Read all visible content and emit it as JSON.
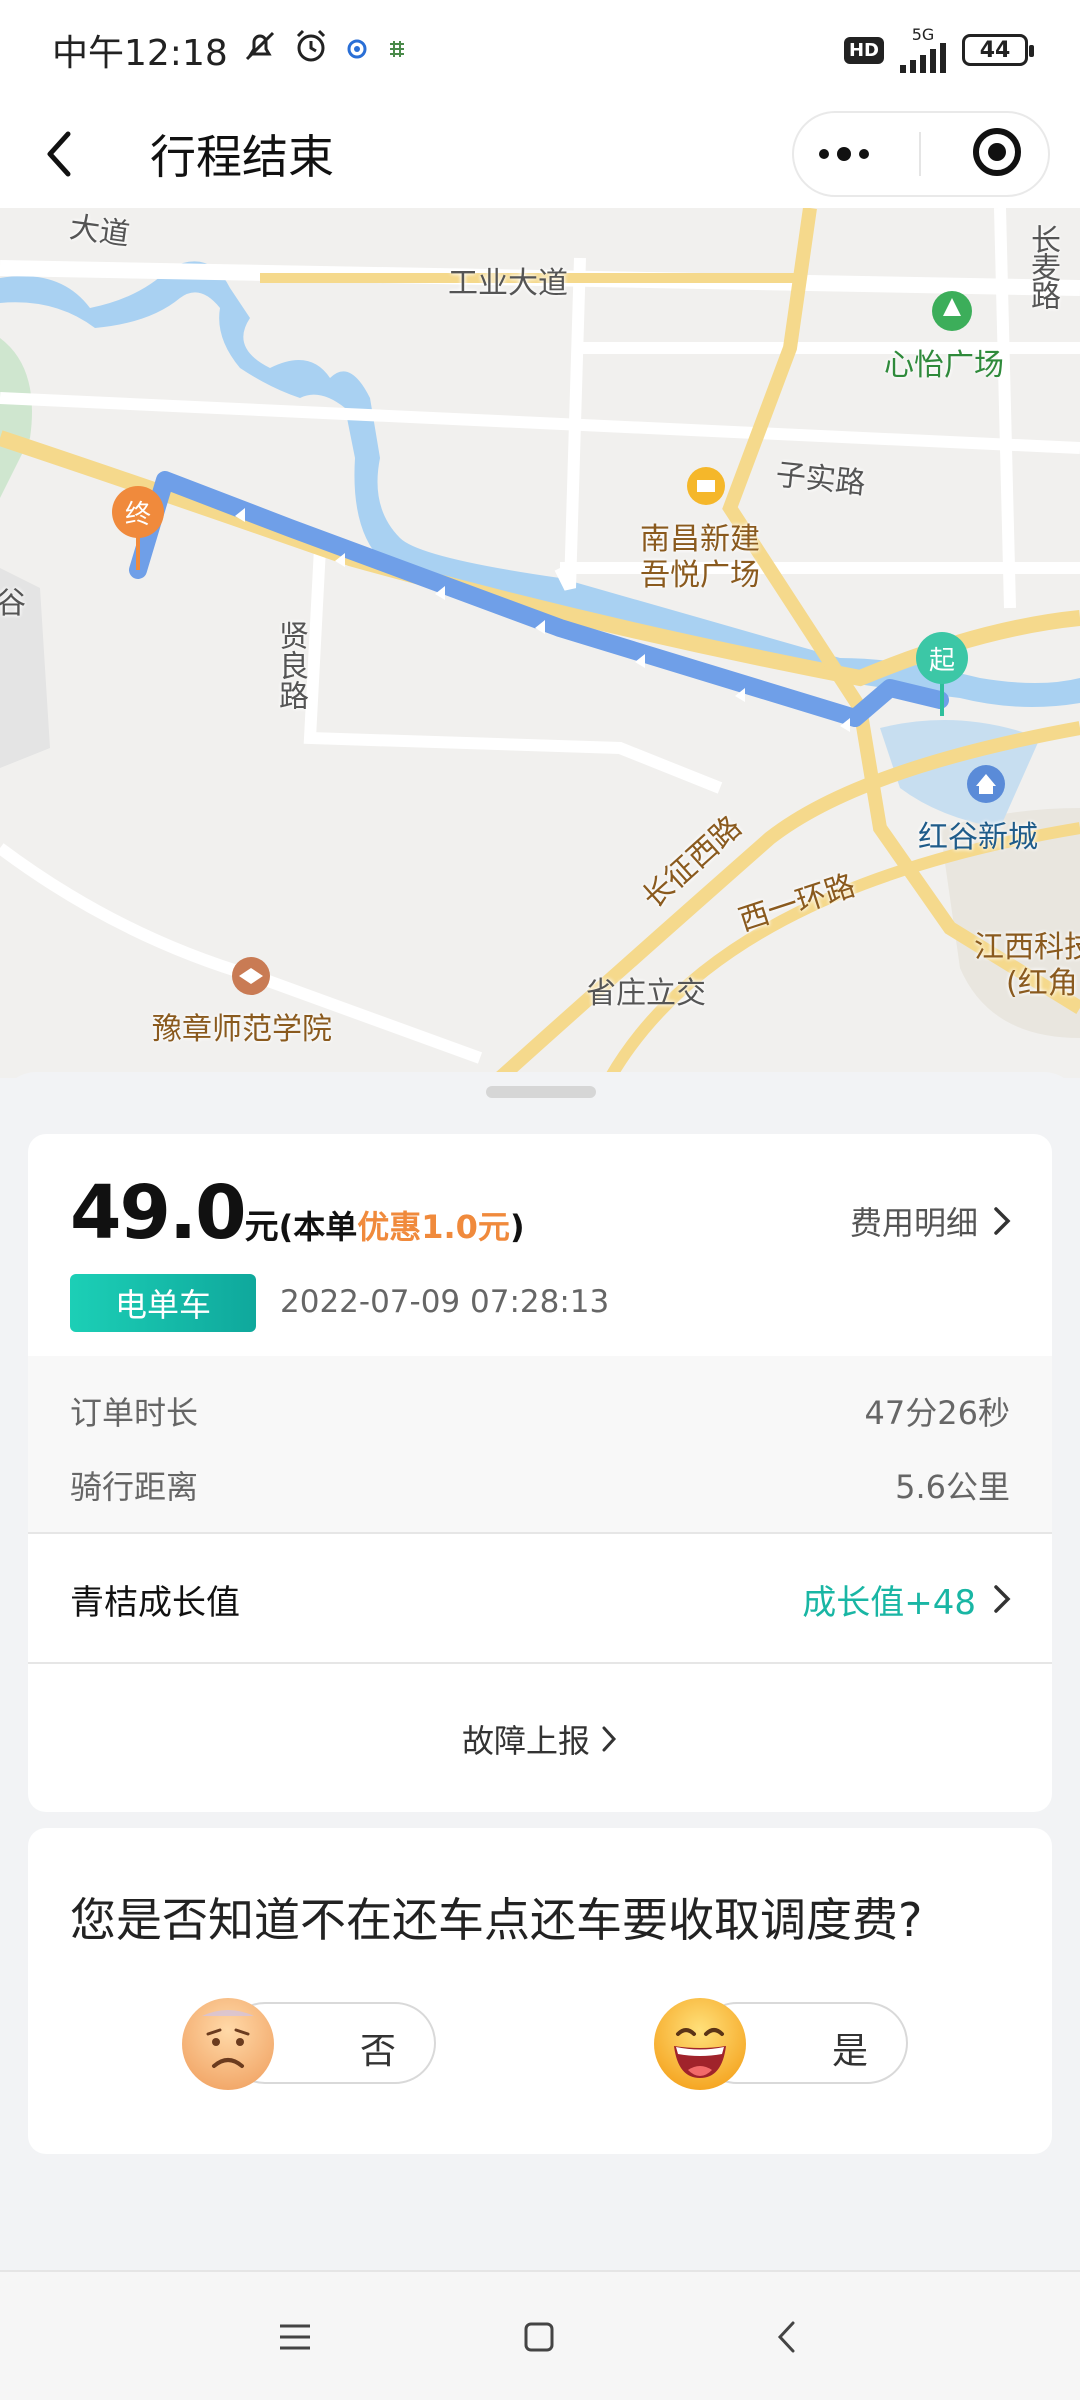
{
  "status_bar": {
    "time": "中午12:18",
    "network": "5G",
    "battery": "44",
    "icons": [
      "mute-bell-icon",
      "alarm-icon",
      "app-notification-icon",
      "hd-icon",
      "signal-icon",
      "battery-icon"
    ]
  },
  "nav": {
    "title": "行程结束",
    "back_icon": "chevron-left-icon",
    "more_icon": "more-dots-icon",
    "close_icon": "target-close-icon"
  },
  "map": {
    "labels": {
      "gongye": "工业大道",
      "changmai": "长麦路",
      "xinyi": "心怡广场",
      "zishi": "子实路",
      "nanchang_1": "南昌新建",
      "nanchang_2": "吾悦广场",
      "xianliang": "贤良路",
      "changzheng": "长征西路",
      "hongu": "红谷新城",
      "xiyihuan": "西一环路",
      "jiangxi_1": "江西科技",
      "jiangxi_2": "(红角",
      "shengzhuang": "省庄立交",
      "yuzhang": "豫章师范学院",
      "gu": "谷",
      "dadao_top": "大道"
    },
    "start_marker": "起",
    "end_marker": "终"
  },
  "fare": {
    "amount": "49.0",
    "unit": "元",
    "note_prefix": "(本单",
    "discount": "优惠1.0元",
    "note_suffix": ")",
    "detail_link": "费用明细",
    "vehicle_type": "电单车",
    "datetime": "2022-07-09 07:28:13",
    "stats": [
      {
        "label": "订单时长",
        "value": "47分26秒"
      },
      {
        "label": "骑行距离",
        "value": "5.6公里"
      }
    ],
    "growth_label": "青桔成长值",
    "growth_value": "成长值+48",
    "fault_report": "故障上报"
  },
  "survey": {
    "question": "您是否知道不在还车点还车要收取调度费?",
    "no_label": "否",
    "yes_label": "是"
  },
  "colors": {
    "accent_teal": "#19b6a4",
    "discount_orange": "#f08a3c",
    "route_blue": "#6f9fe8"
  }
}
